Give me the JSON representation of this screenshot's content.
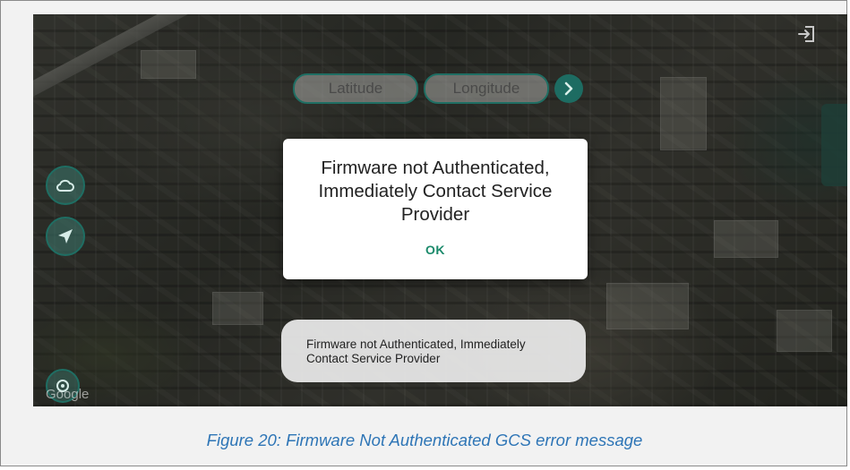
{
  "coordinate_search": {
    "latitude_placeholder": "Latitude",
    "longitude_placeholder": "Longitude"
  },
  "icons": {
    "exit": "exit-icon",
    "cloud": "cloud-icon",
    "navigate": "navigation-arrow-icon",
    "locate": "locate-crosshair-icon",
    "go": "chevron-right-icon"
  },
  "map": {
    "attribution": "Google"
  },
  "dialog": {
    "message": "Firmware not Authenticated, Immediately Contact Service Provider",
    "ok_label": "OK"
  },
  "toast": {
    "message": "Firmware not Authenticated, Immediately Contact Service Provider"
  },
  "caption": "Figure 20: Firmware Not Authenticated GCS error message",
  "colors": {
    "accent": "#1d6c62",
    "ok_text": "#1b8a6b",
    "caption": "#2e75b6"
  }
}
